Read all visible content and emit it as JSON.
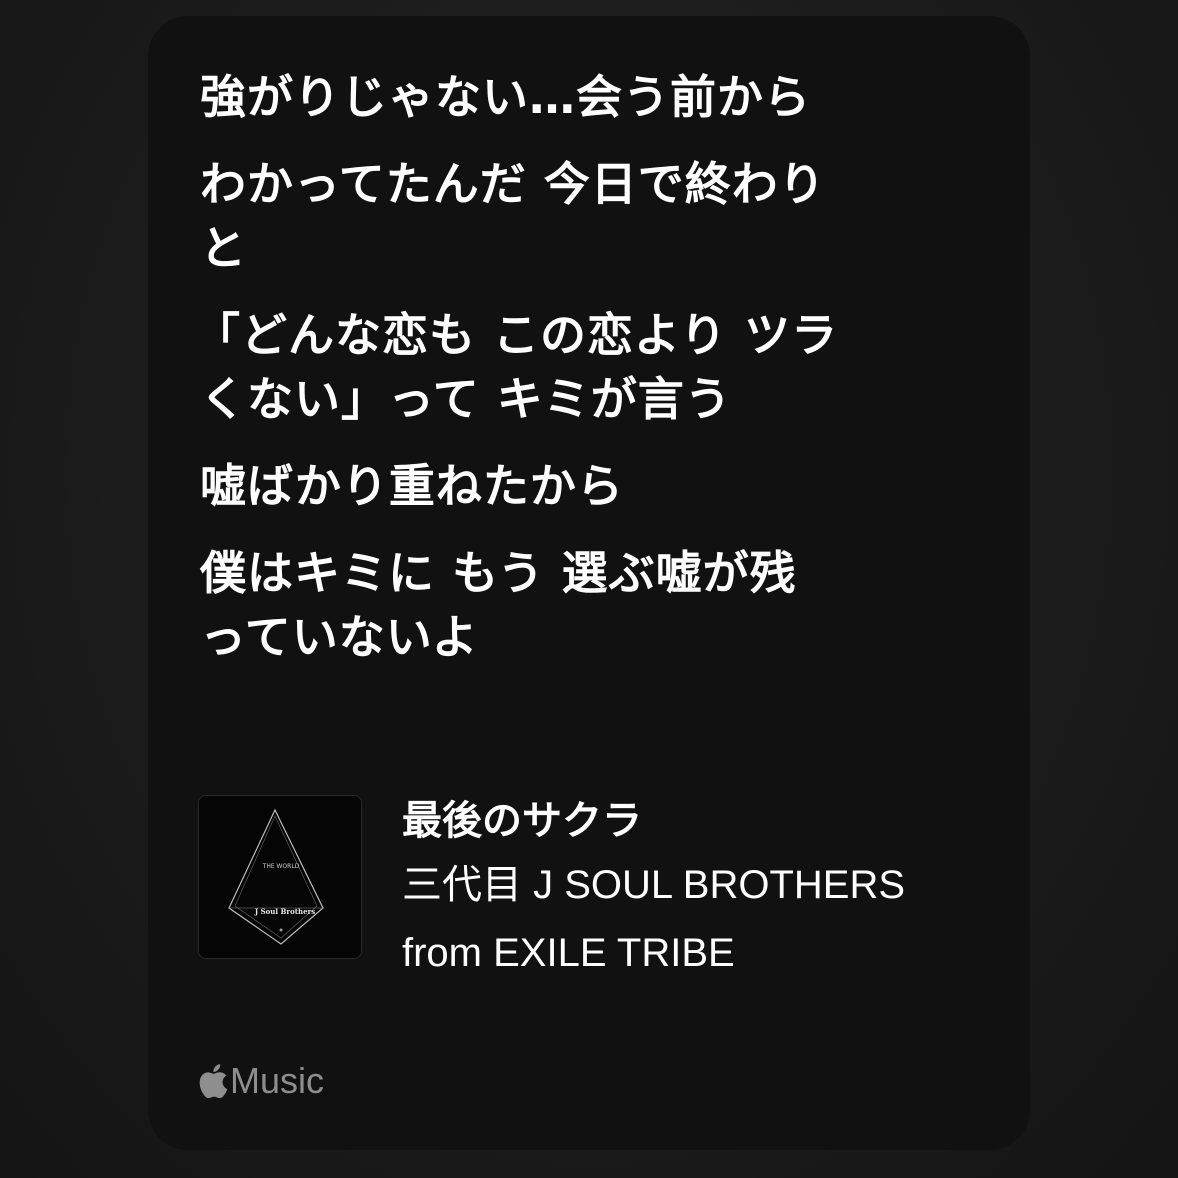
{
  "lyrics": [
    "強がりじゃない…会う前から",
    "わかってたんだ 今日で終わり",
    "と",
    "「どんな恋も この恋より ツラ",
    "くない」って キミが言う",
    "嘘ばかり重ねたから",
    "僕はキミに もう 選ぶ嘘が残",
    "っていないよ"
  ],
  "song": {
    "title": "最後のサクラ",
    "artist": "三代目 J SOUL BROTHERS from EXILE TRIBE",
    "artwork_icon": "album-artwork-diamond",
    "artwork_text_top": "THE WORLD",
    "artwork_text_band": "J Soul Brothers"
  },
  "service": {
    "label": "Music",
    "icon": "apple-logo-icon"
  },
  "colors": {
    "background": "#1c1c1c",
    "card": "#111111",
    "text": "#ffffff",
    "muted": "#8e8e8e"
  }
}
